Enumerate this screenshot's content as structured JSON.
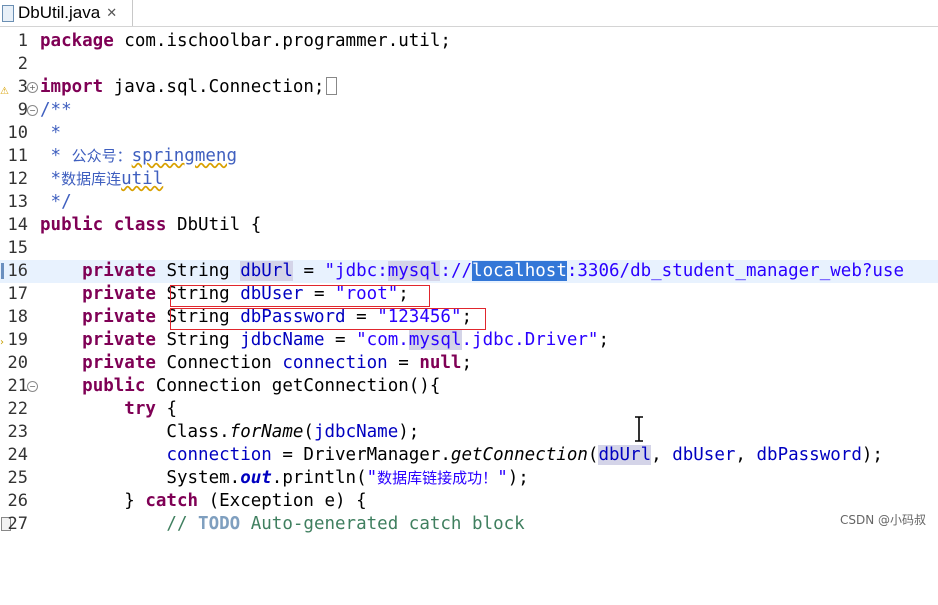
{
  "tab": {
    "title": "DbUtil.java",
    "close": "✕"
  },
  "lines": [
    {
      "n": "1",
      "text": "package com.ischoolbar.programmer.util;"
    },
    {
      "n": "2",
      "text": ""
    },
    {
      "n": "3",
      "text": "import java.sql.Connection;"
    },
    {
      "n": "9",
      "text": "/**"
    },
    {
      "n": "10",
      "text": " *"
    },
    {
      "n": "11",
      "text": " * 公众号：springmeng"
    },
    {
      "n": "12",
      "text": " *数据库连util"
    },
    {
      "n": "13",
      "text": " */"
    },
    {
      "n": "14",
      "text": "public class DbUtil {"
    },
    {
      "n": "15",
      "text": ""
    },
    {
      "n": "16",
      "text": "    private String dbUrl = \"jdbc:mysql://localhost:3306/db_student_manager_web?use"
    },
    {
      "n": "17",
      "text": "    private String dbUser = \"root\";"
    },
    {
      "n": "18",
      "text": "    private String dbPassword = \"123456\";"
    },
    {
      "n": "19",
      "text": "    private String jdbcName = \"com.mysql.jdbc.Driver\";"
    },
    {
      "n": "20",
      "text": "    private Connection connection = null;"
    },
    {
      "n": "21",
      "text": "    public Connection getConnection(){"
    },
    {
      "n": "22",
      "text": "        try {"
    },
    {
      "n": "23",
      "text": "            Class.forName(jdbcName);"
    },
    {
      "n": "24",
      "text": "            connection = DriverManager.getConnection(dbUrl, dbUser, dbPassword);"
    },
    {
      "n": "25",
      "text": "            System.out.println(\"数据库链接成功！\");"
    },
    {
      "n": "26",
      "text": "        } catch (Exception e) {"
    },
    {
      "n": "27",
      "text": "            // TODO Auto-generated catch block"
    }
  ],
  "watermark": "CSDN @小码叔"
}
